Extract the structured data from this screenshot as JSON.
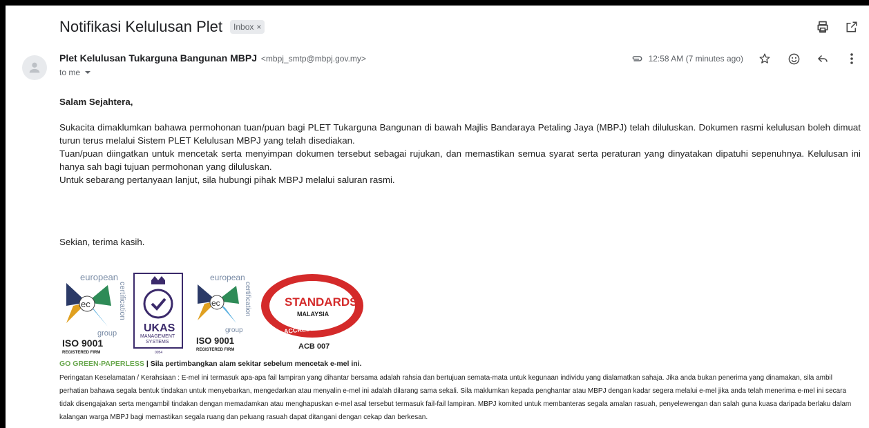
{
  "email": {
    "subject": "Notifikasi Kelulusan Plet",
    "label": "Inbox",
    "label_close": "×",
    "sender_name": "Plet Kelulusan Tukarguna Bangunan MBPJ",
    "sender_email": "<mbpj_smtp@mbpj.gov.my>",
    "recipient": "to me",
    "timestamp": "12:58 AM (7 minutes ago)"
  },
  "icons": {
    "print": "print-icon",
    "popout": "open-in-new-window-icon",
    "attachment": "attachment-icon",
    "star": "star-icon",
    "emoji": "emoji-reaction-icon",
    "reply": "reply-icon",
    "more": "more-vert-icon",
    "avatar": "person-icon"
  },
  "body": {
    "greeting": "Salam Sejahtera,",
    "paragraphs": [
      "Sukacita dimaklumkan bahawa permohonan tuan/puan bagi PLET Tukarguna Bangunan di bawah Majlis Bandaraya Petaling Jaya (MBPJ) telah diluluskan. Dokumen rasmi kelulusan boleh dimuat turun terus melalui Sistem PLET Kelulusan MBPJ yang telah disediakan.",
      "Tuan/puan diingatkan untuk mencetak serta menyimpan dokumen tersebut sebagai rujukan, dan memastikan semua syarat serta peraturan yang dinyatakan dipatuhi sepenuhnya. Kelulusan ini hanya sah bagi tujuan permohonan yang diluluskan.",
      "Untuk sebarang pertanyaan lanjut, sila hubungi pihak MBPJ melalui saluran rasmi."
    ],
    "closing": "Sekian, terima kasih."
  },
  "logos": {
    "ec_top": "european",
    "ec_side": "certification",
    "ec_group": "group",
    "iso": "ISO 9001",
    "registered": "REGISTERED FIRM",
    "ukas": "UKAS",
    "ukas_sub1": "MANAGEMENT",
    "ukas_sub2": "SYSTEMS",
    "ukas_code": "0054",
    "standards": "STANDARDS",
    "malaysia": "MALAYSIA",
    "accredited": "ACCREDITED",
    "acb": "ACB 007"
  },
  "footer": {
    "green": "GO GREEN-PAPERLESS",
    "sep": " | ",
    "notice": "Sila pertimbangkan alam sekitar sebelum mencetak e-mel ini.",
    "disclaimer": "Peringatan Keselamatan / Kerahsiaan : E-mel ini termasuk apa-apa fail lampiran yang dihantar bersama adalah rahsia dan bertujuan semata-mata untuk kegunaan individu yang dialamatkan sahaja. Jika anda bukan penerima yang dinamakan, sila ambil perhatian bahawa segala bentuk tindakan untuk menyebarkan, mengedarkan atau menyalin e-mel ini adalah dilarang sama sekali. Sila maklumkan kepada penghantar atau MBPJ dengan kadar segera melalui e-mel jika anda telah menerima e-mel ini secara tidak disengajakan serta mengambil tindakan dengan memadamkan atau menghapuskan e-mel asal tersebut termasuk fail-fail lampiran. MBPJ komited untuk membanteras segala amalan rasuah, penyelewengan dan salah guna kuasa daripada berlaku dalam kalangan warga MBPJ bagi memastikan segala ruang dan peluang rasuah dapat ditangani dengan cekap dan berkesan."
  }
}
